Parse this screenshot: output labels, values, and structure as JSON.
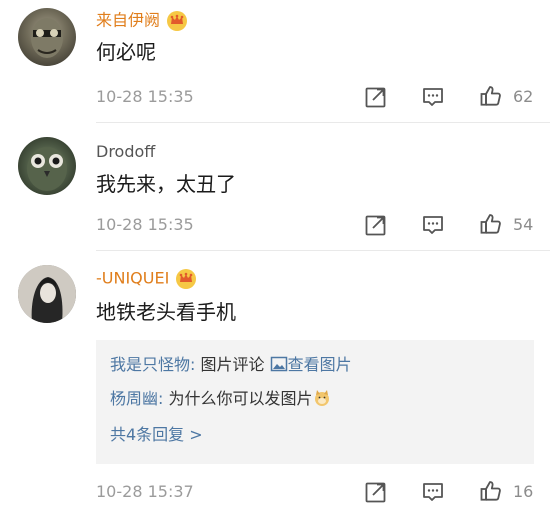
{
  "comments": [
    {
      "username": "来自伊阙",
      "text": "何必呢",
      "time": "10-28 15:35",
      "likes": "62"
    },
    {
      "username": "Drodoff",
      "text": "我先来，太丑了",
      "time": "10-28 15:35",
      "likes": "54"
    },
    {
      "username": "-UNIQUEI",
      "text": "地铁老头看手机",
      "time": "10-28 15:37",
      "likes": "16",
      "replies": [
        {
          "user": "我是只怪物:",
          "text": " 图片评论 ",
          "link": "查看图片"
        },
        {
          "user": "杨周幽:",
          "text": " 为什么你可以发图片"
        }
      ],
      "more_replies": "共4条回复 >"
    }
  ],
  "icons": {
    "repost": "repost-icon",
    "comment": "comment-icon",
    "like": "like-icon",
    "crown": "crown-badge-icon",
    "picture": "picture-icon",
    "emoji": "doge-emoji-icon"
  },
  "colors": {
    "vip_name": "#e07e1c",
    "link_blue": "#4d77a3",
    "meta_gray": "#9b9b9b"
  }
}
